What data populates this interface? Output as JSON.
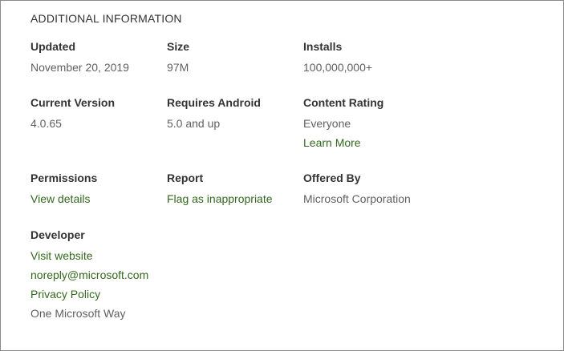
{
  "section_title": "ADDITIONAL INFORMATION",
  "colors": {
    "label": "#333333",
    "value": "#616161",
    "link": "#33691e",
    "border": "#8a8a8a"
  },
  "updated": {
    "label": "Updated",
    "value": "November 20, 2019"
  },
  "size": {
    "label": "Size",
    "value": "97M"
  },
  "installs": {
    "label": "Installs",
    "value": "100,000,000+"
  },
  "current_version": {
    "label": "Current Version",
    "value": "4.0.65"
  },
  "requires_android": {
    "label": "Requires Android",
    "value": "5.0 and up"
  },
  "content_rating": {
    "label": "Content Rating",
    "value": "Everyone",
    "link": "Learn More"
  },
  "permissions": {
    "label": "Permissions",
    "link": "View details"
  },
  "report": {
    "label": "Report",
    "link": "Flag as inappropriate"
  },
  "offered_by": {
    "label": "Offered By",
    "value": "Microsoft Corporation"
  },
  "developer": {
    "label": "Developer",
    "website": "Visit website",
    "email": "noreply@microsoft.com",
    "privacy": "Privacy Policy",
    "address": "One Microsoft Way"
  }
}
